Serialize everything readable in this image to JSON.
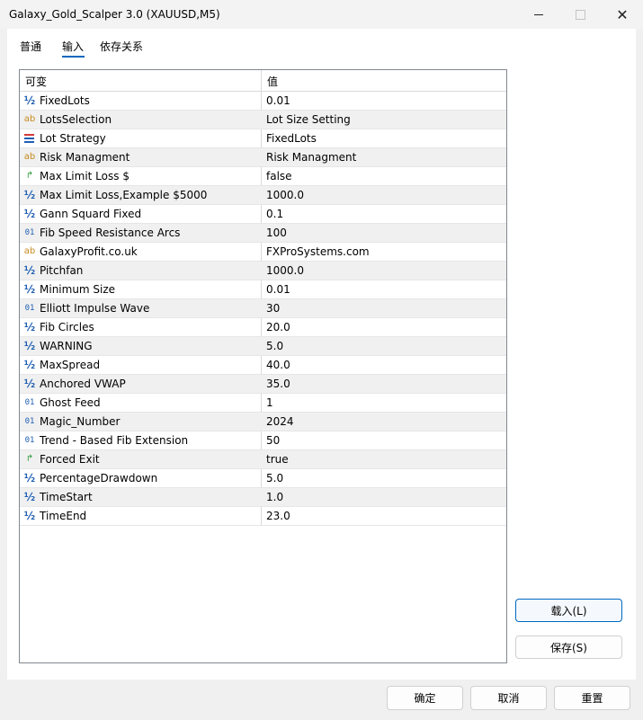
{
  "window": {
    "title": "Galaxy_Gold_Scalper 3.0 (XAUUSD,M5)",
    "minimize_icon": "minimize-icon",
    "maximize_icon": "maximize-icon",
    "close_icon": "close-icon",
    "close_glyph": "✕"
  },
  "tabs": [
    {
      "label": "普通"
    },
    {
      "label": "输入",
      "selected": true
    },
    {
      "label": "依存关系"
    }
  ],
  "table": {
    "columns": [
      "可变",
      "值"
    ],
    "rows": [
      {
        "type": "double",
        "icon": "½",
        "name": "FixedLots",
        "value": "0.01"
      },
      {
        "type": "string",
        "icon": "ab",
        "name": "LotsSelection",
        "value": "Lot Size Setting"
      },
      {
        "type": "enum",
        "icon": "",
        "name": "Lot Strategy",
        "value": "FixedLots"
      },
      {
        "type": "string",
        "icon": "ab",
        "name": "Risk Managment",
        "value": "Risk Managment"
      },
      {
        "type": "bool",
        "icon": "↱",
        "name": "Max Limit Loss $",
        "value": "false"
      },
      {
        "type": "double",
        "icon": "½",
        "name": "Max Limit Loss,Example $5000",
        "value": "1000.0"
      },
      {
        "type": "double",
        "icon": "½",
        "name": "Gann Squard Fixed",
        "value": "0.1"
      },
      {
        "type": "int",
        "icon": "01",
        "name": "Fib Speed Resistance Arcs",
        "value": "100"
      },
      {
        "type": "string",
        "icon": "ab",
        "name": "GalaxyProfit.co.uk",
        "value": "FXProSystems.com"
      },
      {
        "type": "double",
        "icon": "½",
        "name": "Pitchfan",
        "value": "1000.0"
      },
      {
        "type": "double",
        "icon": "½",
        "name": "Minimum Size",
        "value": "0.01"
      },
      {
        "type": "int",
        "icon": "01",
        "name": "Elliott Impulse Wave",
        "value": "30"
      },
      {
        "type": "double",
        "icon": "½",
        "name": "Fib Circles",
        "value": "20.0"
      },
      {
        "type": "double",
        "icon": "½",
        "name": "WARNING",
        "value": "5.0"
      },
      {
        "type": "double",
        "icon": "½",
        "name": "MaxSpread",
        "value": "40.0"
      },
      {
        "type": "double",
        "icon": "½",
        "name": "Anchored VWAP",
        "value": "35.0"
      },
      {
        "type": "int",
        "icon": "01",
        "name": "Ghost Feed",
        "value": "1"
      },
      {
        "type": "int",
        "icon": "01",
        "name": "Magic_Number",
        "value": "2024"
      },
      {
        "type": "int",
        "icon": "01",
        "name": "Trend - Based Fib Extension",
        "value": "50"
      },
      {
        "type": "bool",
        "icon": "↱",
        "name": "Forced Exit",
        "value": "true"
      },
      {
        "type": "double",
        "icon": "½",
        "name": "PercentageDrawdown",
        "value": "5.0"
      },
      {
        "type": "double",
        "icon": "½",
        "name": "TimeStart",
        "value": "1.0"
      },
      {
        "type": "double",
        "icon": "½",
        "name": "TimeEnd",
        "value": "23.0"
      }
    ]
  },
  "side_buttons": {
    "load": "载入(L)",
    "save": "保存(S)"
  },
  "footer": {
    "ok": "确定",
    "cancel": "取消",
    "reset": "重置"
  },
  "colors": {
    "accent": "#0067c0",
    "double_icon": "#1f5fb4",
    "string_icon": "#c68a1e",
    "bool_icon": "#2e9b3a",
    "enum_icon_top": "#d23a3a",
    "enum_icon_bottom": "#1f5fb4"
  }
}
